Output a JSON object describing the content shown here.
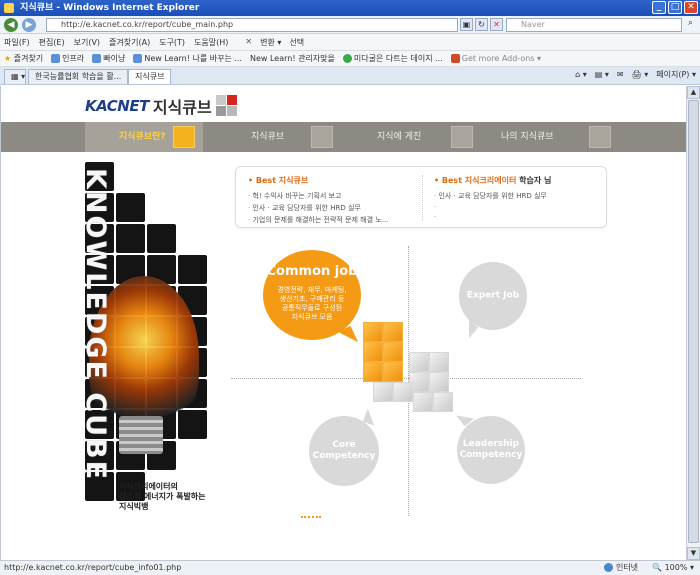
{
  "window": {
    "title": "지식큐브 - Windows Internet Explorer",
    "min": "_",
    "max": "□",
    "close": "✕"
  },
  "address": {
    "url": "http://e.kacnet.co.kr/report/cube_main.php",
    "search_placeholder": "Naver",
    "go": "⌕"
  },
  "menu": {
    "items": [
      "파일(F)",
      "편집(E)",
      "보기(V)",
      "즐겨찾기(A)",
      "도구(T)",
      "도움말(H)"
    ],
    "extra": [
      "✕",
      "변환 ▾",
      "선택"
    ]
  },
  "links": {
    "favorites": "즐겨찾기",
    "items": [
      "인프라",
      "빠이냥",
      "New Learn! 나를 바꾸는 ...",
      "New Learn! 관리자맞을",
      "미다굴은 다트는 데이지 ...",
      "Get more Add-ons ▾"
    ]
  },
  "tabs": {
    "items": [
      "한국능률협회 학습을 활...",
      "지식큐브"
    ],
    "tools": [
      "⌂ ▾",
      "▤ ▾",
      "✉",
      "🖨 ▾",
      "페이지(P) ▾"
    ]
  },
  "site": {
    "logo_kac": "KACNET",
    "logo_name": "지식큐브",
    "gnb": [
      "지식큐브란?",
      "지식큐브",
      "지식에 게진",
      "나의 지식큐브"
    ],
    "vertical_title": "KNOWLEDGE CUBE",
    "tagline": [
      "지식크리에이터의",
      "창조적 에너지가 폭발하는",
      "지식빅뱅"
    ],
    "best_left": {
      "title": "Best 지식큐브",
      "items": [
        "혁! 수익사 바꾸는 기획서 보고",
        "인사 · 교육 담당자를 위한 HRD 실무",
        "기업의 문제를 해결하는 전략적 문제 해결 노..."
      ]
    },
    "best_right": {
      "title_prefix": "Best 지식크리에이터",
      "title_suffix": "학습자 님",
      "items": [
        "인사 · 교육 담당자를 위한 HRD 실무",
        "",
        ""
      ]
    },
    "common": {
      "title": "Common job",
      "desc": [
        "경영전략, 재무, 마케팅,",
        "생산기초, 구매관리 등",
        "공통직무들로 구성된",
        "지식큐브 모음"
      ]
    },
    "expert": "Expert Job",
    "core": [
      "Core",
      "Competency"
    ],
    "leader": [
      "Leadership",
      "Competency"
    ]
  },
  "status": {
    "url": "http://e.kacnet.co.kr/report/cube_info01.php",
    "zone": "인터넷",
    "zoom": "100%"
  },
  "colors": {
    "accent": "#f59a14",
    "gnb": "#8d8a84",
    "title_bar": "#1a4fb8"
  }
}
